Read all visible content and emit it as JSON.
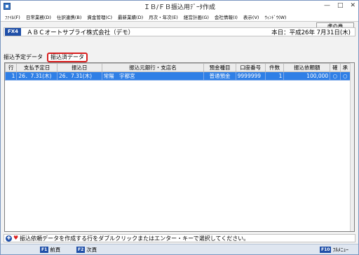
{
  "window": {
    "title": "ＩＢ/ＦＢ振込用ﾃﾞｰﾀ作成",
    "controls": [
      "—",
      "□",
      "✕"
    ]
  },
  "menu": {
    "items": [
      "ﾌｧｲﾙ(F)",
      "日常業務(D)",
      "仕訳連携(B)",
      "資金管理(C)",
      "最新業績(D)",
      "月次・年次(E)",
      "経営計画(G)",
      "会社情報(I)",
      "表示(V)",
      "ｳｨﾝﾄﾞｳ(W)"
    ]
  },
  "toolbar": {
    "tora_label": "虎の巻"
  },
  "company": {
    "badge": "FX4",
    "name": "ＡＢＣオートサプライ株式会社（デモ）",
    "today": "本日：平成26年 7月31日(木)"
  },
  "tabs": [
    {
      "label": "振込予定データ",
      "active": false
    },
    {
      "label": "振込済データ",
      "active": true
    }
  ],
  "grid": {
    "columns": [
      "行",
      "支払予定日",
      "振込日",
      "振込元銀行・支店名",
      "預金種目",
      "口座番号",
      "件数",
      "振込依頼額",
      "確",
      "承"
    ],
    "rows": [
      {
        "cells": [
          "1",
          "26．7.31(木)",
          "26．7.31(木)",
          "常陽　宇都宮",
          "普通預金",
          "9999999",
          "1",
          "100,000",
          "○",
          "○"
        ]
      }
    ]
  },
  "status": {
    "message": "振込依頼データを作成する行をダブルクリックまたはエンター・キーで選択してください。"
  },
  "fkeys": [
    {
      "key": "F1",
      "label": "前頁"
    },
    {
      "key": "F2",
      "label": "次頁"
    },
    {
      "key": "F10",
      "label": "ﾌﾙﾒﾆｭｰ"
    }
  ],
  "colors": {
    "selection": "#2f7fe6",
    "badge": "#1f4fa8",
    "active_tab_border": "#d81e1e"
  }
}
